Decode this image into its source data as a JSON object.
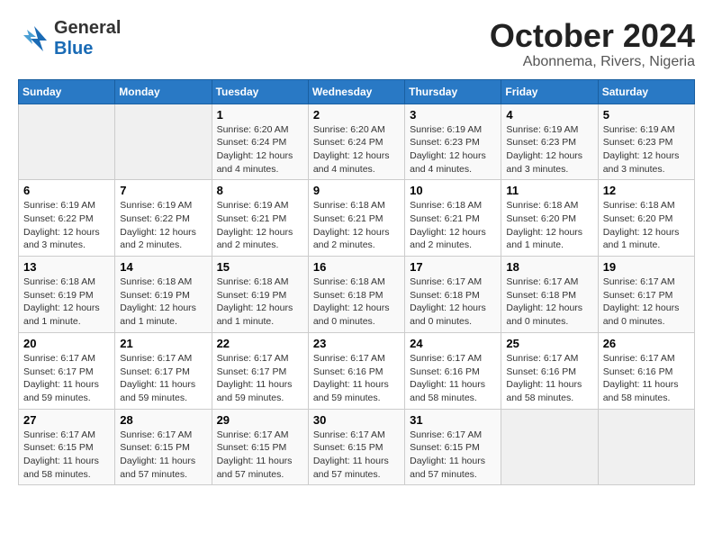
{
  "logo": {
    "general": "General",
    "blue": "Blue"
  },
  "title": "October 2024",
  "subtitle": "Abonnema, Rivers, Nigeria",
  "weekdays": [
    "Sunday",
    "Monday",
    "Tuesday",
    "Wednesday",
    "Thursday",
    "Friday",
    "Saturday"
  ],
  "weeks": [
    [
      {
        "day": "",
        "info": ""
      },
      {
        "day": "",
        "info": ""
      },
      {
        "day": "1",
        "info": "Sunrise: 6:20 AM\nSunset: 6:24 PM\nDaylight: 12 hours\nand 4 minutes."
      },
      {
        "day": "2",
        "info": "Sunrise: 6:20 AM\nSunset: 6:24 PM\nDaylight: 12 hours\nand 4 minutes."
      },
      {
        "day": "3",
        "info": "Sunrise: 6:19 AM\nSunset: 6:23 PM\nDaylight: 12 hours\nand 4 minutes."
      },
      {
        "day": "4",
        "info": "Sunrise: 6:19 AM\nSunset: 6:23 PM\nDaylight: 12 hours\nand 3 minutes."
      },
      {
        "day": "5",
        "info": "Sunrise: 6:19 AM\nSunset: 6:23 PM\nDaylight: 12 hours\nand 3 minutes."
      }
    ],
    [
      {
        "day": "6",
        "info": "Sunrise: 6:19 AM\nSunset: 6:22 PM\nDaylight: 12 hours\nand 3 minutes."
      },
      {
        "day": "7",
        "info": "Sunrise: 6:19 AM\nSunset: 6:22 PM\nDaylight: 12 hours\nand 2 minutes."
      },
      {
        "day": "8",
        "info": "Sunrise: 6:19 AM\nSunset: 6:21 PM\nDaylight: 12 hours\nand 2 minutes."
      },
      {
        "day": "9",
        "info": "Sunrise: 6:18 AM\nSunset: 6:21 PM\nDaylight: 12 hours\nand 2 minutes."
      },
      {
        "day": "10",
        "info": "Sunrise: 6:18 AM\nSunset: 6:21 PM\nDaylight: 12 hours\nand 2 minutes."
      },
      {
        "day": "11",
        "info": "Sunrise: 6:18 AM\nSunset: 6:20 PM\nDaylight: 12 hours\nand 1 minute."
      },
      {
        "day": "12",
        "info": "Sunrise: 6:18 AM\nSunset: 6:20 PM\nDaylight: 12 hours\nand 1 minute."
      }
    ],
    [
      {
        "day": "13",
        "info": "Sunrise: 6:18 AM\nSunset: 6:19 PM\nDaylight: 12 hours\nand 1 minute."
      },
      {
        "day": "14",
        "info": "Sunrise: 6:18 AM\nSunset: 6:19 PM\nDaylight: 12 hours\nand 1 minute."
      },
      {
        "day": "15",
        "info": "Sunrise: 6:18 AM\nSunset: 6:19 PM\nDaylight: 12 hours\nand 1 minute."
      },
      {
        "day": "16",
        "info": "Sunrise: 6:18 AM\nSunset: 6:18 PM\nDaylight: 12 hours\nand 0 minutes."
      },
      {
        "day": "17",
        "info": "Sunrise: 6:17 AM\nSunset: 6:18 PM\nDaylight: 12 hours\nand 0 minutes."
      },
      {
        "day": "18",
        "info": "Sunrise: 6:17 AM\nSunset: 6:18 PM\nDaylight: 12 hours\nand 0 minutes."
      },
      {
        "day": "19",
        "info": "Sunrise: 6:17 AM\nSunset: 6:17 PM\nDaylight: 12 hours\nand 0 minutes."
      }
    ],
    [
      {
        "day": "20",
        "info": "Sunrise: 6:17 AM\nSunset: 6:17 PM\nDaylight: 11 hours\nand 59 minutes."
      },
      {
        "day": "21",
        "info": "Sunrise: 6:17 AM\nSunset: 6:17 PM\nDaylight: 11 hours\nand 59 minutes."
      },
      {
        "day": "22",
        "info": "Sunrise: 6:17 AM\nSunset: 6:17 PM\nDaylight: 11 hours\nand 59 minutes."
      },
      {
        "day": "23",
        "info": "Sunrise: 6:17 AM\nSunset: 6:16 PM\nDaylight: 11 hours\nand 59 minutes."
      },
      {
        "day": "24",
        "info": "Sunrise: 6:17 AM\nSunset: 6:16 PM\nDaylight: 11 hours\nand 58 minutes."
      },
      {
        "day": "25",
        "info": "Sunrise: 6:17 AM\nSunset: 6:16 PM\nDaylight: 11 hours\nand 58 minutes."
      },
      {
        "day": "26",
        "info": "Sunrise: 6:17 AM\nSunset: 6:16 PM\nDaylight: 11 hours\nand 58 minutes."
      }
    ],
    [
      {
        "day": "27",
        "info": "Sunrise: 6:17 AM\nSunset: 6:15 PM\nDaylight: 11 hours\nand 58 minutes."
      },
      {
        "day": "28",
        "info": "Sunrise: 6:17 AM\nSunset: 6:15 PM\nDaylight: 11 hours\nand 57 minutes."
      },
      {
        "day": "29",
        "info": "Sunrise: 6:17 AM\nSunset: 6:15 PM\nDaylight: 11 hours\nand 57 minutes."
      },
      {
        "day": "30",
        "info": "Sunrise: 6:17 AM\nSunset: 6:15 PM\nDaylight: 11 hours\nand 57 minutes."
      },
      {
        "day": "31",
        "info": "Sunrise: 6:17 AM\nSunset: 6:15 PM\nDaylight: 11 hours\nand 57 minutes."
      },
      {
        "day": "",
        "info": ""
      },
      {
        "day": "",
        "info": ""
      }
    ]
  ]
}
